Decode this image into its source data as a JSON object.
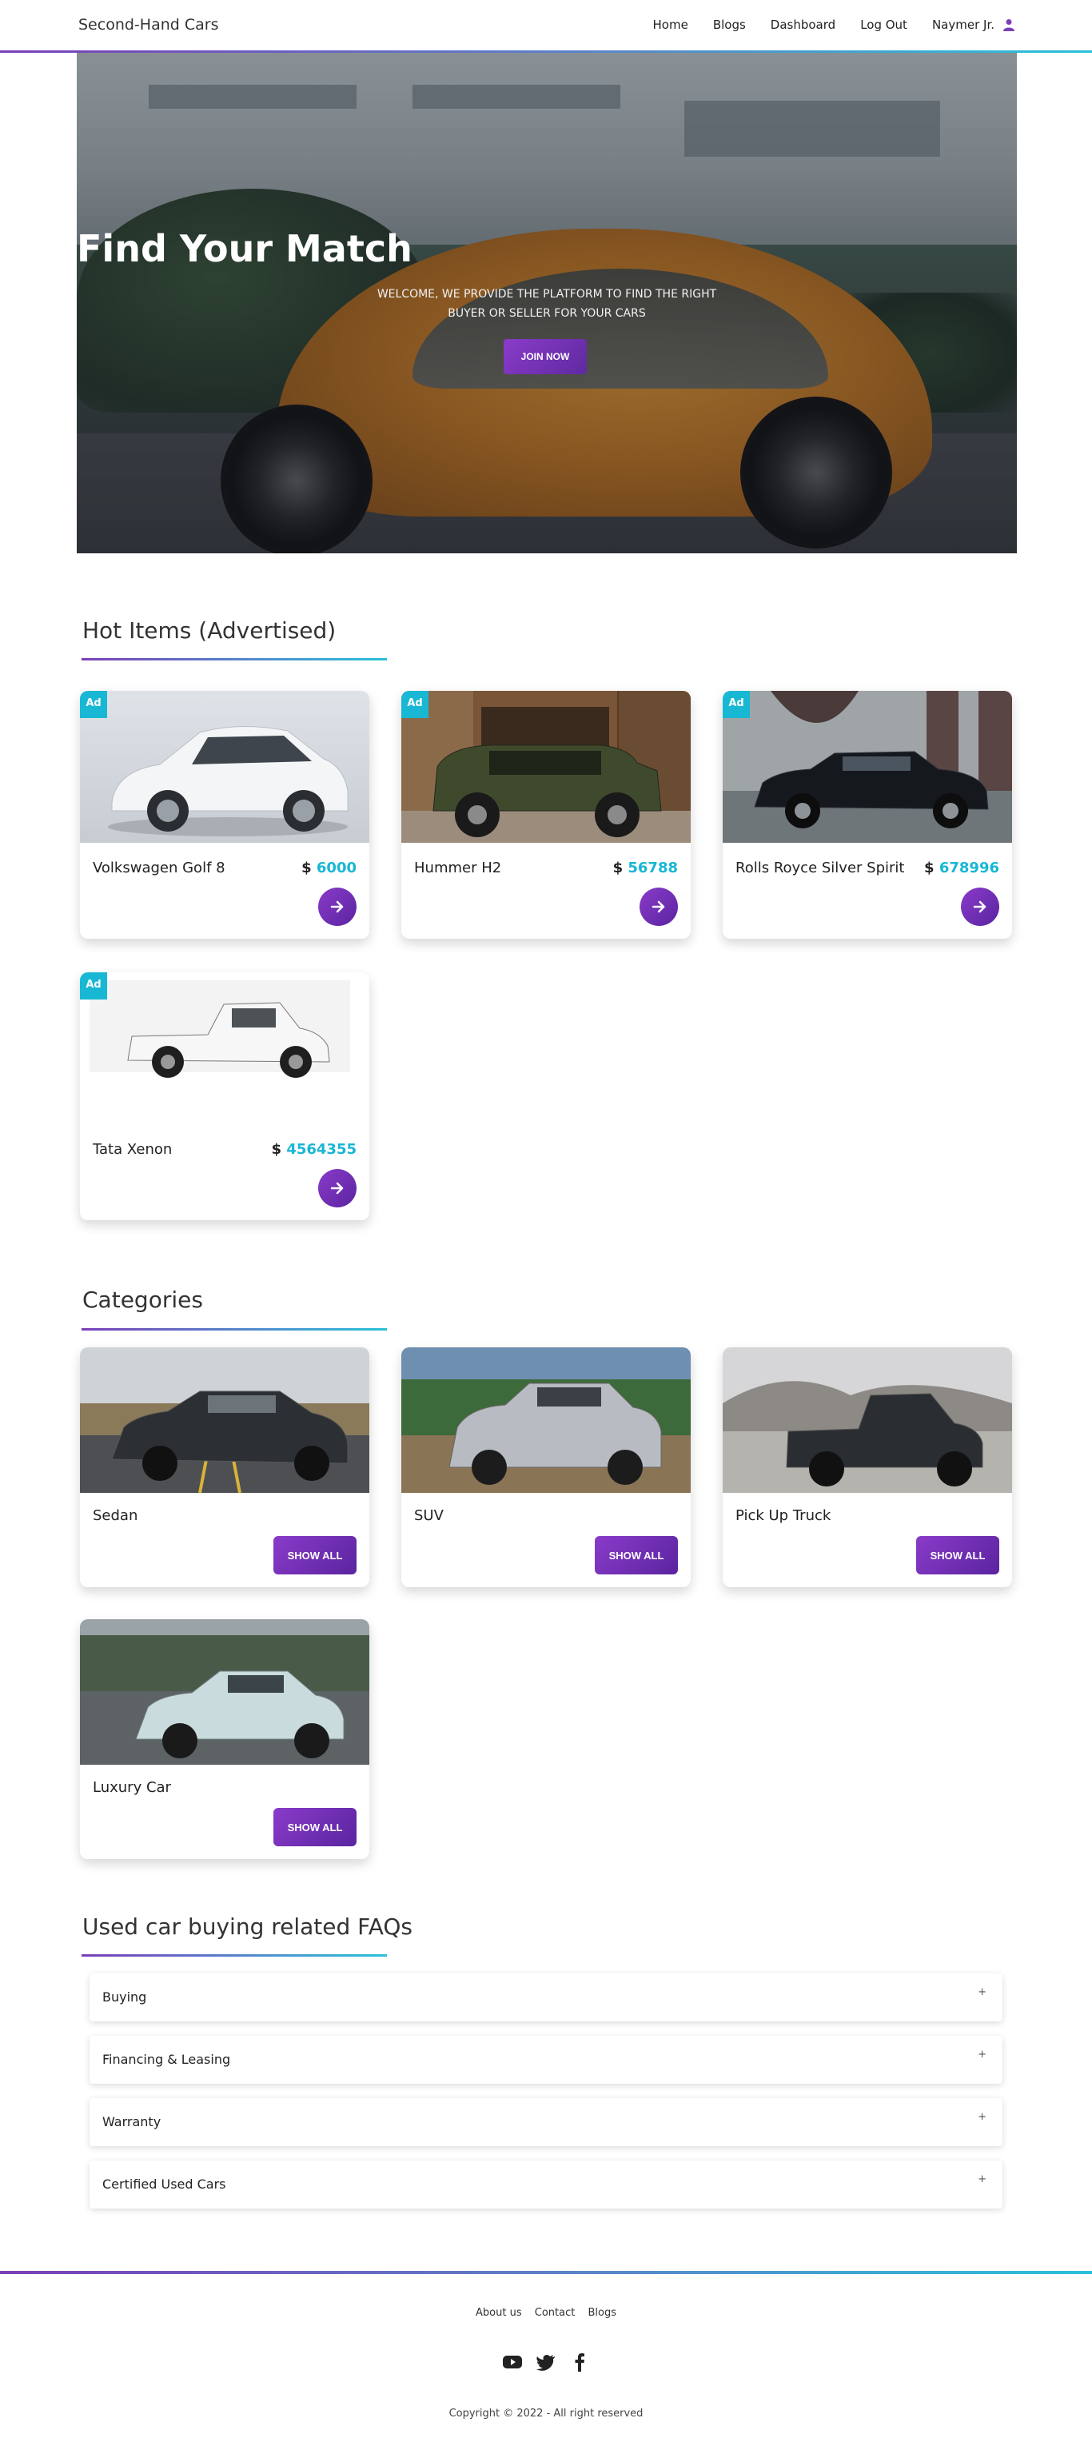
{
  "nav": {
    "brand": "Second-Hand Cars",
    "links": [
      "Home",
      "Blogs",
      "Dashboard",
      "Log Out"
    ],
    "user": "Naymer Jr.",
    "user_icon": "user-icon"
  },
  "hero": {
    "title": "Find Your Match",
    "subtitle": "WELCOME, WE PROVIDE THE PLATFORM TO FIND THE RIGHT BUYER OR SELLER FOR YOUR CARS",
    "button": "JOIN NOW"
  },
  "hot_items": {
    "title": "Hot Items (Advertised)",
    "badge": "Ad",
    "currency": "$",
    "items": [
      {
        "name": "Volkswagen Golf 8",
        "price": "6000"
      },
      {
        "name": "Hummer H2",
        "price": "56788"
      },
      {
        "name": "Rolls Royce Silver Spirit",
        "price": "678996"
      },
      {
        "name": "Tata Xenon",
        "price": "4564355"
      }
    ],
    "arrow_icon": "arrow-right-icon"
  },
  "categories": {
    "title": "Categories",
    "button": "SHOW ALL",
    "items": [
      {
        "name": "Sedan"
      },
      {
        "name": "SUV"
      },
      {
        "name": "Pick Up Truck"
      },
      {
        "name": "Luxury Car"
      }
    ]
  },
  "faq": {
    "title": "Used car buying related FAQs",
    "items": [
      "Buying",
      "Financing & Leasing",
      "Warranty",
      "Certified Used Cars"
    ],
    "expand": "+"
  },
  "footer": {
    "links": [
      "About us",
      "Contact",
      "Blogs"
    ],
    "social": [
      "youtube-icon",
      "twitter-icon",
      "facebook-icon"
    ],
    "copyright": "Copyright © 2022 - All right reserved"
  },
  "colors": {
    "accent_purple": "#7b3fb8",
    "accent_cyan": "#18b7d4"
  }
}
